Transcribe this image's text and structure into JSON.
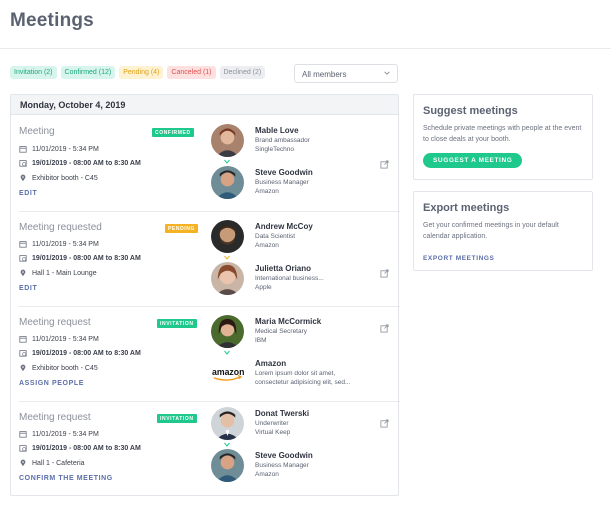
{
  "header": {
    "title": "Meetings"
  },
  "filters": {
    "invitation": "Invitation (2)",
    "confirmed": "Confirmed (12)",
    "pending": "Pending (4)",
    "canceled": "Canceled (1)",
    "declined": "Declined (2)"
  },
  "members_select": {
    "value": "All members"
  },
  "day": {
    "label": "Monday, October 4, 2019"
  },
  "meetings": [
    {
      "title": "Meeting",
      "badge": "CONFIRMED",
      "date": "11/01/2019 - 5:34 PM",
      "time": "19/01/2019 - 08:00 AM to 8:30 AM",
      "location": "Exhibitor booth - C45",
      "action": "EDIT",
      "person1": {
        "name": "Mable Love",
        "line1": "Brand ambassador",
        "line2": "SingleTechno"
      },
      "person2": {
        "name": "Steve Goodwin",
        "line1": "Business Manager",
        "line2": "Amazon"
      }
    },
    {
      "title": "Meeting requested",
      "badge": "PENDING",
      "date": "11/01/2019 - 5:34 PM",
      "time": "19/01/2019 - 08:00 AM to 8:30 AM",
      "location": "Hall 1 - Main Lounge",
      "action": "EDIT",
      "person1": {
        "name": "Andrew McCoy",
        "line1": "Data Scientist",
        "line2": "Amazon"
      },
      "person2": {
        "name": "Julietta Oriano",
        "line1": "International business...",
        "line2": "Apple"
      }
    },
    {
      "title": "Meeting request",
      "badge": "INVITATION",
      "date": "11/01/2019 - 5:34 PM",
      "time": "19/01/2019 - 08:00 AM to 8:30 AM",
      "location": "Exhibitor booth - C45",
      "action": "ASSIGN PEOPLE",
      "person1": {
        "name": "Maria McCormick",
        "line1": "Medical Secretary",
        "line2": "IBM"
      },
      "person2": {
        "name": "Amazon",
        "line1": "Lorem ipsum dolor sit amet,",
        "line2": "consectetur adipisicing elit, sed...",
        "logo": "amazon"
      }
    },
    {
      "title": "Meeting request",
      "badge": "INVITATION",
      "date": "11/01/2019 - 5:34 PM",
      "time": "19/01/2019 - 08:00 AM to 8:30 AM",
      "location": "Hall 1 - Cafeteria",
      "action": "CONFIRM THE MEETING",
      "person1": {
        "name": "Donat Twerski",
        "line1": "Underwriter",
        "line2": "Virtual Keep"
      },
      "person2": {
        "name": "Steve Goodwin",
        "line1": "Business Manager",
        "line2": "Amazon"
      }
    }
  ],
  "suggest": {
    "title": "Suggest meetings",
    "text": "Schedule private meetings with people at the event to close deals at your booth.",
    "button": "SUGGEST A MEETING"
  },
  "export": {
    "title": "Export meetings",
    "text": "Get your confirmed meetings in your default calendar application.",
    "link": "EXPORT MEETINGS"
  },
  "colors": {
    "accent_green": "#1ec98b",
    "pending_yellow": "#f5b323",
    "link_blue": "#5b6ea8"
  }
}
